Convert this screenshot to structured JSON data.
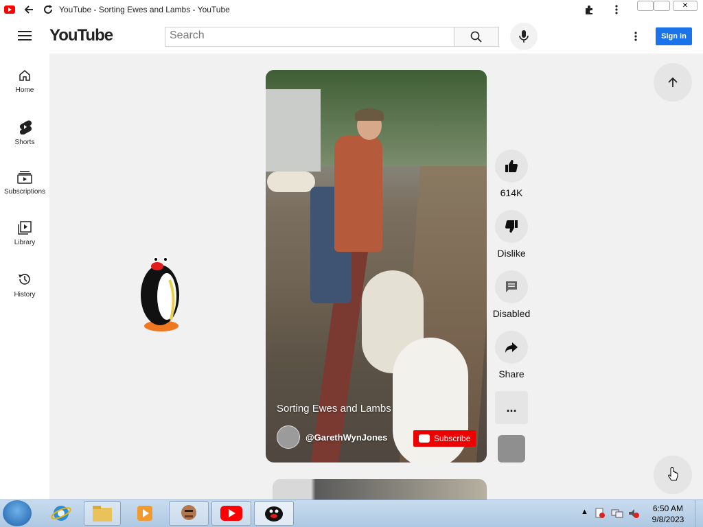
{
  "window": {
    "title": "YouTube - Sorting Ewes and Lambs - YouTube"
  },
  "header": {
    "logo_text": "YouTube",
    "search_placeholder": "Search",
    "signin_label": "Sign in"
  },
  "sidebar": {
    "items": [
      {
        "label": "Home",
        "icon": "home-icon"
      },
      {
        "label": "Shorts",
        "icon": "shorts-icon"
      },
      {
        "label": "Subscriptions",
        "icon": "subscriptions-icon"
      },
      {
        "label": "Library",
        "icon": "library-icon"
      },
      {
        "label": "History",
        "icon": "history-icon"
      }
    ]
  },
  "video": {
    "title": "Sorting Ewes and Lambs",
    "channel": "@GarethWynJones",
    "subscribe_label": "Subscribe"
  },
  "actions": {
    "like_count": "614K",
    "dislike_label": "Dislike",
    "comments_label": "Disabled",
    "share_label": "Share",
    "more_label": "..."
  },
  "taskbar": {
    "time": "6:50 AM",
    "date": "9/8/2023"
  },
  "colors": {
    "accent": "#ff0000",
    "signin": "#1a73e8",
    "background": "#f1f1f1"
  }
}
